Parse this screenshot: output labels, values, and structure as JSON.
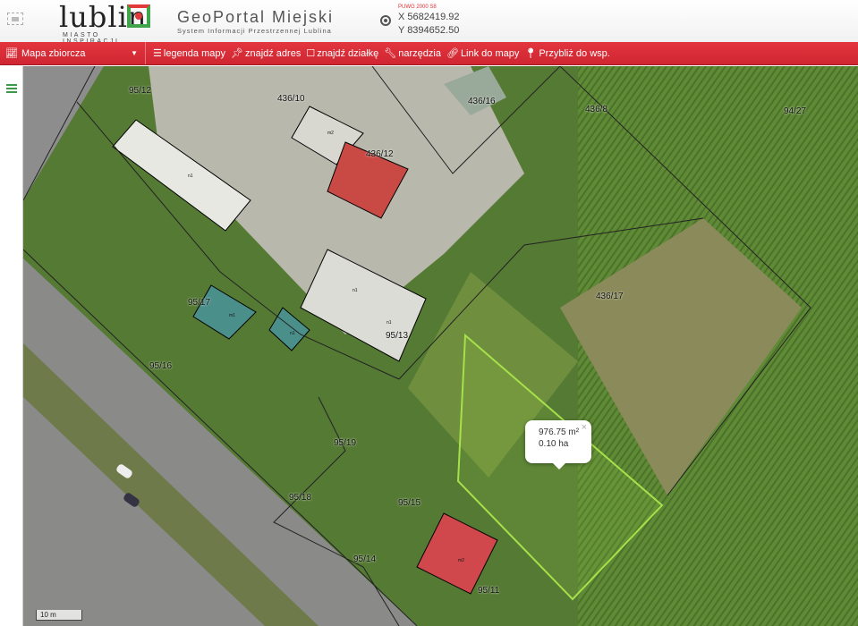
{
  "header": {
    "logo_word": "lublin",
    "logo_sub": "MIASTO INSPIRACJI",
    "title": "GeoPortal Miejski",
    "subtitle": "System Informacji Przestrzennej Lublina",
    "coord_system": "PUWG 2000 S8",
    "coord_x": "X 5682419.92",
    "coord_y": "Y 8394652.50"
  },
  "toolbar": {
    "map_select": "Mapa zbiorcza",
    "buttons": [
      {
        "label": "legenda mapy",
        "icon": "list-icon"
      },
      {
        "label": "znajdź adres",
        "icon": "pin-icon"
      },
      {
        "label": "znajdź działkę",
        "icon": "square-icon"
      },
      {
        "label": "narzędzia",
        "icon": "wrench-icon"
      },
      {
        "label": "Link do mapy",
        "icon": "link-icon"
      },
      {
        "label": "Przybliż do wsp.",
        "icon": "marker-icon"
      }
    ]
  },
  "map": {
    "parcels": [
      "95/12",
      "436/10",
      "436/16",
      "436/8",
      "94/27",
      "436/12",
      "436/17",
      "95/17",
      "95/13",
      "95/16",
      "95/19",
      "95/18",
      "95/15",
      "95/14",
      "95/11"
    ],
    "buildings": [
      "m2",
      "n1",
      "n1",
      "n1",
      "m1",
      "n1",
      "m2"
    ],
    "popup": {
      "area": "976.75 m²",
      "hectares": "0.10 ha",
      "close": "×"
    },
    "scale": "10 m",
    "highlight_color": "#a6e04a"
  }
}
